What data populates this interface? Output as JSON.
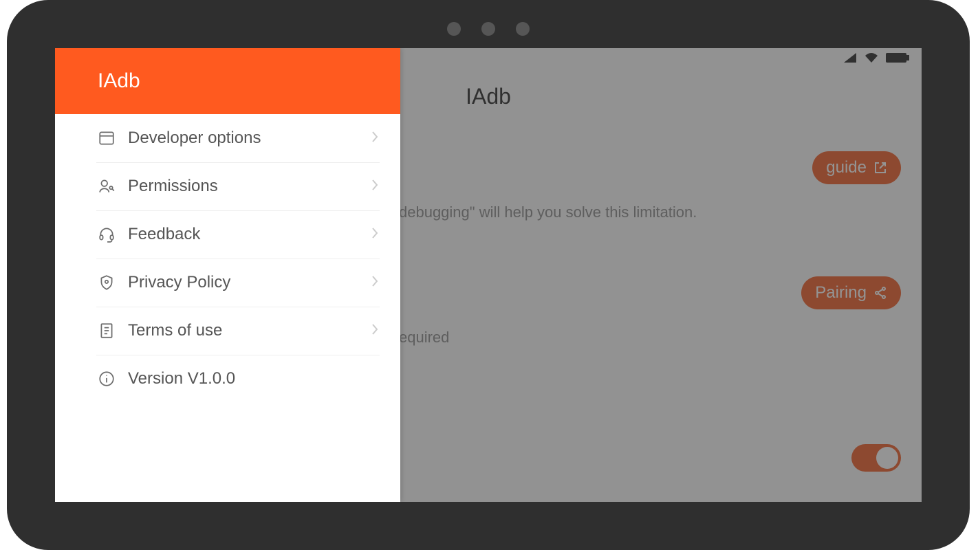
{
  "app_title": "IAdb",
  "main_title": "IAdb",
  "status": {
    "signal": true,
    "wifi": true,
    "battery": true
  },
  "main": {
    "guide_button": "guide",
    "pairing_button": "Pairing",
    "hint_fragment": "debugging\" will help you solve this limitation.",
    "required_fragment": "equired"
  },
  "toggle_on": true,
  "drawer": {
    "title": "IAdb",
    "items": [
      {
        "icon": "developer",
        "label": "Developer options",
        "chevron": true
      },
      {
        "icon": "permissions",
        "label": "Permissions",
        "chevron": true
      },
      {
        "icon": "feedback",
        "label": "Feedback",
        "chevron": true
      },
      {
        "icon": "privacy",
        "label": "Privacy Policy",
        "chevron": true
      },
      {
        "icon": "terms",
        "label": "Terms of use",
        "chevron": true
      },
      {
        "icon": "version",
        "label": "Version V1.0.0",
        "chevron": false
      }
    ]
  }
}
